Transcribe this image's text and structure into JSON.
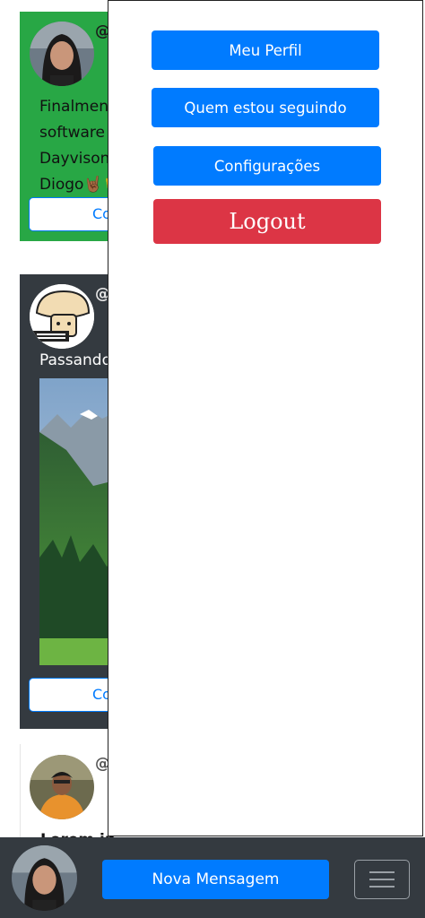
{
  "feed": {
    "posts": [
      {
        "handle": "@",
        "text_lines": [
          "Finalmen",
          "software",
          "Dayvison",
          "Diogo🤘🏾🤘"
        ],
        "button_label": "Co"
      },
      {
        "handle": "@",
        "text_lines": [
          "Passando"
        ],
        "button_label": "Co"
      },
      {
        "handle": "@",
        "text_lines": [
          "Lorem ip"
        ]
      }
    ]
  },
  "side_menu": {
    "profile_label": "Meu Perfil",
    "following_label": "Quem estou seguindo",
    "settings_label": "Configurações",
    "logout_label": "Logout"
  },
  "bottom_bar": {
    "new_message_label": "Nova Mensagem",
    "menu_icon": "hamburger-icon"
  },
  "colors": {
    "primary": "#007bff",
    "danger": "#dc3545",
    "success": "#28a745",
    "dark": "#343a40"
  }
}
